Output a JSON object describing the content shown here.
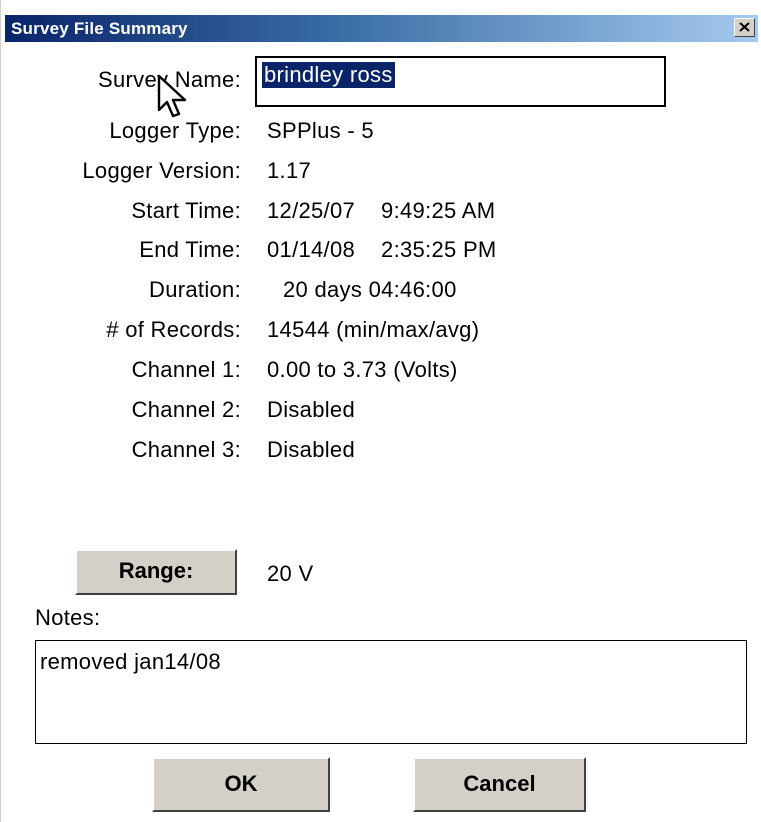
{
  "window": {
    "title": "Survey File Summary",
    "close_label": "close"
  },
  "fields": {
    "survey_name_label": "Survey Name:",
    "survey_name_value": "brindley ross",
    "logger_type_label": "Logger Type:",
    "logger_type_value": "SPPlus - 5",
    "logger_version_label": "Logger Version:",
    "logger_version_value": "1.17",
    "start_time_label": "Start Time:",
    "start_date": "12/25/07",
    "start_clock": "9:49:25 AM",
    "end_time_label": "End Time:",
    "end_date": "01/14/08",
    "end_clock": "2:35:25 PM",
    "duration_label": "Duration:",
    "duration_value": "20 days 04:46:00",
    "records_label": "# of Records:",
    "records_value": "14544 (min/max/avg)",
    "channel1_label": "Channel 1:",
    "channel1_value": "0.00 to 3.73 (Volts)",
    "channel2_label": "Channel 2:",
    "channel2_value": "Disabled",
    "channel3_label": "Channel 3:",
    "channel3_value": "Disabled"
  },
  "range": {
    "button_label": "Range:",
    "value": "20 V"
  },
  "notes": {
    "label": "Notes:",
    "value": "removed jan14/08"
  },
  "buttons": {
    "ok_label": "OK",
    "cancel_label": "Cancel"
  },
  "colors": {
    "title_bar_start": "#0a246a",
    "title_bar_end": "#a6caf0",
    "button_face": "#d4d0c8",
    "selection": "#0a246a"
  },
  "icons": {
    "close": "close-icon",
    "cursor": "mouse-pointer-icon"
  }
}
